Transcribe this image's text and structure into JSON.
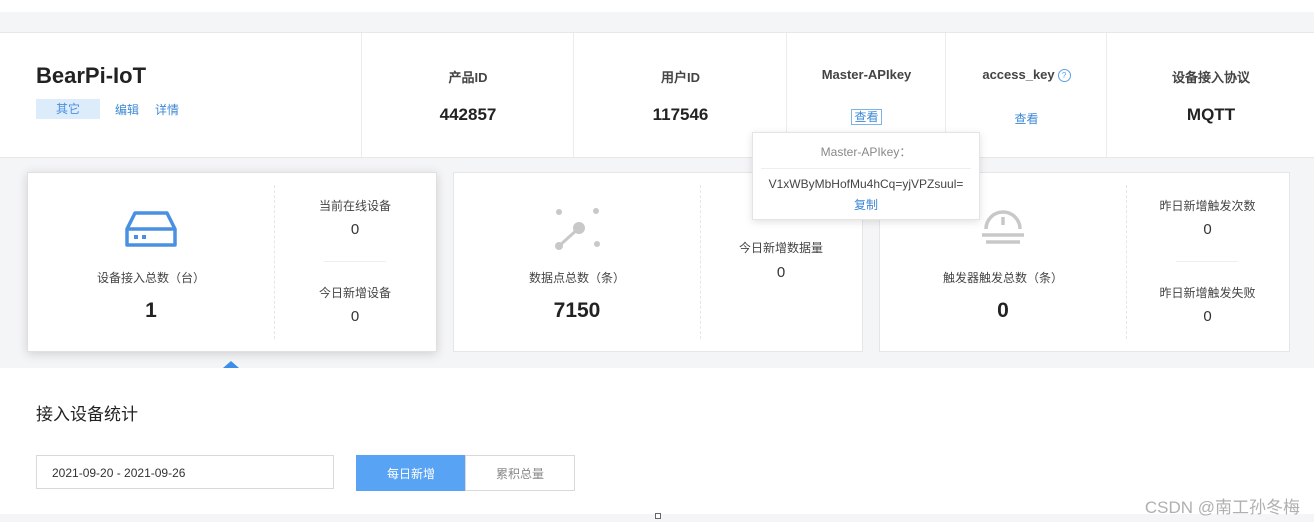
{
  "product": {
    "name": "BearPi-IoT",
    "tag": "其它",
    "edit_link": "编辑",
    "detail_link": "详情"
  },
  "header_columns": {
    "product_id": {
      "label": "产品ID",
      "value": "442857"
    },
    "user_id": {
      "label": "用户ID",
      "value": "117546"
    },
    "master_apikey": {
      "label": "Master-APIkey",
      "action": "查看"
    },
    "access_key": {
      "label": "access_key",
      "help": "?",
      "action": "查看"
    },
    "protocol": {
      "label": "设备接入协议",
      "value": "MQTT"
    }
  },
  "popover": {
    "title": "Master-APIkey：",
    "key": "V1xWByMbHofMu4hCq=yjVPZsuul=",
    "copy": "复制"
  },
  "cards": {
    "devices": {
      "main_label": "设备接入总数（台）",
      "main_value": "1",
      "online_label": "当前在线设备",
      "online_value": "0",
      "new_today_label": "今日新增设备",
      "new_today_value": "0"
    },
    "datapoints": {
      "main_label": "数据点总数（条）",
      "main_value": "7150",
      "new_today_label": "今日新增数据量",
      "new_today_value": "0"
    },
    "triggers": {
      "main_label": "触发器触发总数（条）",
      "main_value": "0",
      "yesterday_count_label": "昨日新增触发次数",
      "yesterday_count_value": "0",
      "yesterday_fail_label": "昨日新增触发失败",
      "yesterday_fail_value": "0"
    }
  },
  "stats": {
    "title": "接入设备统计",
    "date_range": "2021-09-20 - 2021-09-26",
    "tab_daily": "每日新增",
    "tab_cumulative": "累积总量"
  },
  "watermark": "CSDN @南工孙冬梅",
  "colors": {
    "accent": "#3d88d6",
    "active_tab": "#59a3f5",
    "tag_bg": "#dcecfb",
    "icon_blue": "#4a90e2",
    "icon_grey": "#c8c8c8"
  }
}
